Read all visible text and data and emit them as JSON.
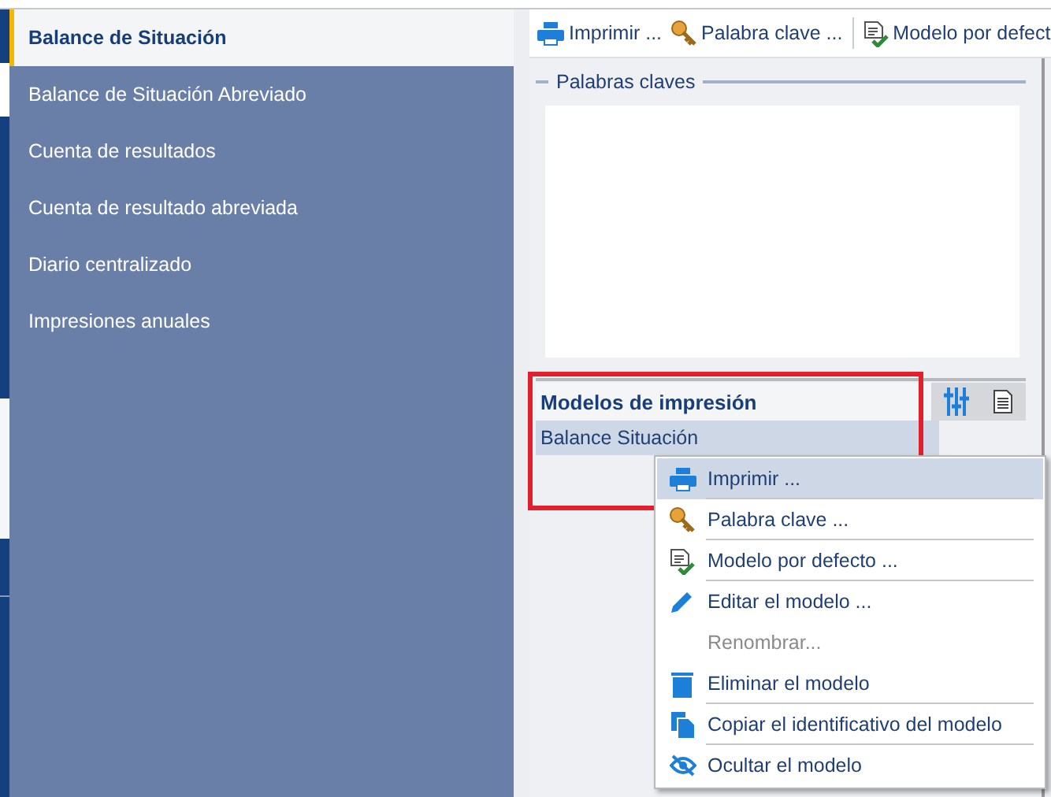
{
  "sidebar": {
    "items": [
      {
        "label": "Balance de Situación",
        "selected": true
      },
      {
        "label": "Balance de Situación Abreviado",
        "selected": false
      },
      {
        "label": "Cuenta de resultados",
        "selected": false
      },
      {
        "label": "Cuenta de resultado abreviada",
        "selected": false
      },
      {
        "label": "Diario centralizado",
        "selected": false
      },
      {
        "label": "Impresiones anuales",
        "selected": false
      }
    ]
  },
  "toolbar": {
    "buttons": [
      {
        "label": "Imprimir ..."
      },
      {
        "label": "Palabra clave ..."
      },
      {
        "label": "Modelo por defect"
      }
    ]
  },
  "keywords": {
    "legend": "Palabras claves"
  },
  "models": {
    "title": "Modelos de impresión",
    "rows": [
      {
        "label": "Balance Situación",
        "selected": true
      }
    ]
  },
  "context_menu": {
    "items": [
      {
        "label": "Imprimir ...",
        "selected": true,
        "disabled": false,
        "separator_after": true
      },
      {
        "label": "Palabra clave ...",
        "selected": false,
        "disabled": false,
        "separator_after": true
      },
      {
        "label": "Modelo por defecto ...",
        "selected": false,
        "disabled": false,
        "separator_after": true
      },
      {
        "label": "Editar el modelo ...",
        "selected": false,
        "disabled": false,
        "separator_after": false
      },
      {
        "label": "Renombrar...",
        "selected": false,
        "disabled": true,
        "separator_after": false
      },
      {
        "label": "Eliminar el modelo",
        "selected": false,
        "disabled": false,
        "separator_after": true
      },
      {
        "label": "Copiar el identificativo del modelo",
        "selected": false,
        "disabled": false,
        "separator_after": true
      },
      {
        "label": "Ocultar el modelo",
        "selected": false,
        "disabled": false,
        "separator_after": false
      }
    ]
  }
}
